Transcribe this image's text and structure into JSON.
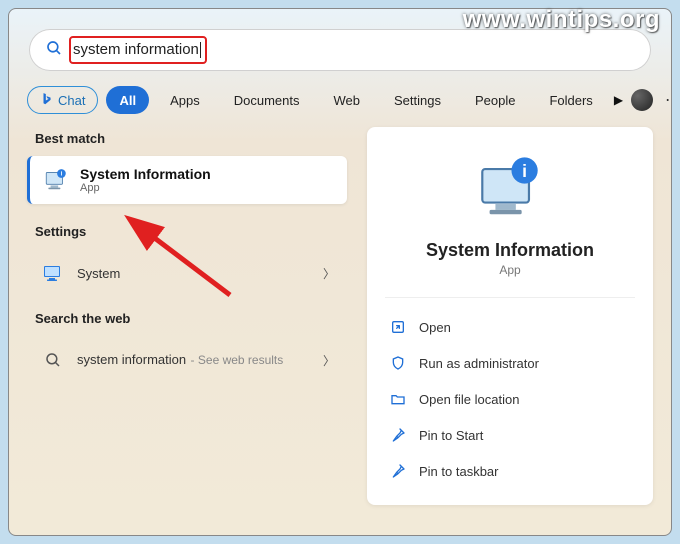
{
  "watermark": "www.wintips.org",
  "search": {
    "query": "system information"
  },
  "tabs": {
    "chat": "Chat",
    "all": "All",
    "apps": "Apps",
    "documents": "Documents",
    "web": "Web",
    "settings": "Settings",
    "people": "People",
    "folders": "Folders"
  },
  "left": {
    "best_match_heading": "Best match",
    "best_match": {
      "title": "System Information",
      "subtitle": "App"
    },
    "settings_heading": "Settings",
    "settings_item": "System",
    "web_heading": "Search the web",
    "web_item": {
      "query": "system information",
      "hint": "See web results"
    }
  },
  "right": {
    "title": "System Information",
    "subtitle": "App",
    "actions": {
      "open": "Open",
      "run_admin": "Run as administrator",
      "open_location": "Open file location",
      "pin_start": "Pin to Start",
      "pin_taskbar": "Pin to taskbar"
    }
  }
}
